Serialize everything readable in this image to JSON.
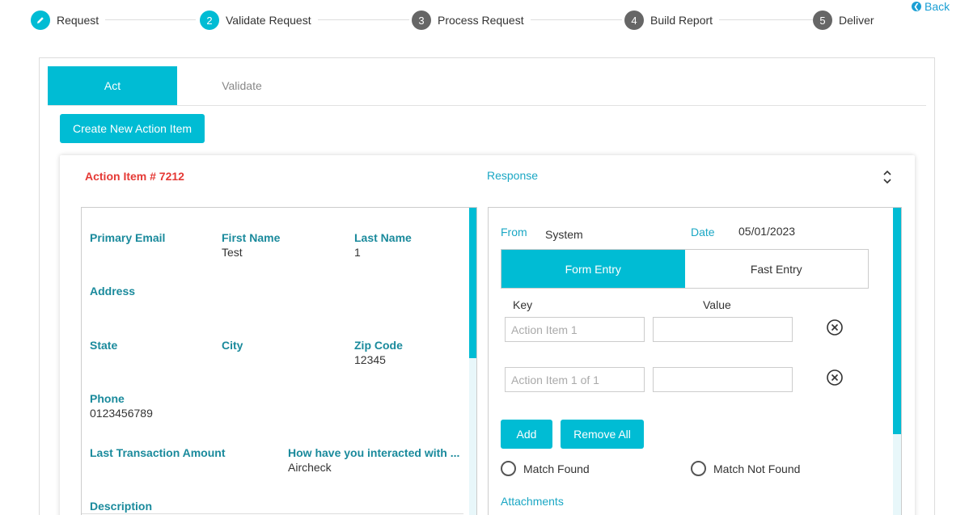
{
  "stepper": {
    "steps": [
      {
        "number": "",
        "label": "Request",
        "state": "done"
      },
      {
        "number": "2",
        "label": "Validate Request",
        "state": "active"
      },
      {
        "number": "3",
        "label": "Process Request",
        "state": "pending"
      },
      {
        "number": "4",
        "label": "Build Report",
        "state": "pending"
      },
      {
        "number": "5",
        "label": "Deliver",
        "state": "pending"
      }
    ]
  },
  "back": {
    "label": "Back"
  },
  "tabs": [
    {
      "label": "Act",
      "active": true
    },
    {
      "label": "Validate",
      "active": false
    }
  ],
  "create_button": {
    "label": "Create New Action Item"
  },
  "card": {
    "title": "Action Item # 7212",
    "response_label": "Response"
  },
  "details": {
    "primary_email": {
      "label": "Primary Email",
      "value": ""
    },
    "first_name": {
      "label": "First Name",
      "value": "Test"
    },
    "last_name": {
      "label": "Last Name",
      "value": "1"
    },
    "address": {
      "label": "Address",
      "value": ""
    },
    "state": {
      "label": "State",
      "value": ""
    },
    "city": {
      "label": "City",
      "value": ""
    },
    "zip_code": {
      "label": "Zip Code",
      "value": "12345"
    },
    "phone": {
      "label": "Phone",
      "value": "0123456789"
    },
    "last_transaction_amount": {
      "label": "Last Transaction Amount",
      "value": ""
    },
    "interaction": {
      "label": "How have you interacted with ...",
      "value": "Aircheck"
    },
    "description": {
      "label": "Description",
      "value": ""
    }
  },
  "response": {
    "from_label": "From",
    "from_value": "System",
    "date_label": "Date",
    "date_value": "05/01/2023",
    "mode_options": [
      {
        "label": "Form Entry",
        "selected": true
      },
      {
        "label": "Fast Entry",
        "selected": false
      }
    ],
    "key_header": "Key",
    "value_header": "Value",
    "rows": [
      {
        "key_placeholder": "Action Item 1",
        "value": ""
      },
      {
        "key_placeholder": "Action Item 1 of 1",
        "value": ""
      }
    ],
    "add_label": "Add",
    "remove_all_label": "Remove All",
    "match_found_label": "Match Found",
    "match_not_found_label": "Match Not Found",
    "attachments_label": "Attachments"
  },
  "colors": {
    "accent": "#00bcd4",
    "title_red": "#e53935",
    "field_label": "#1a8a9c"
  }
}
